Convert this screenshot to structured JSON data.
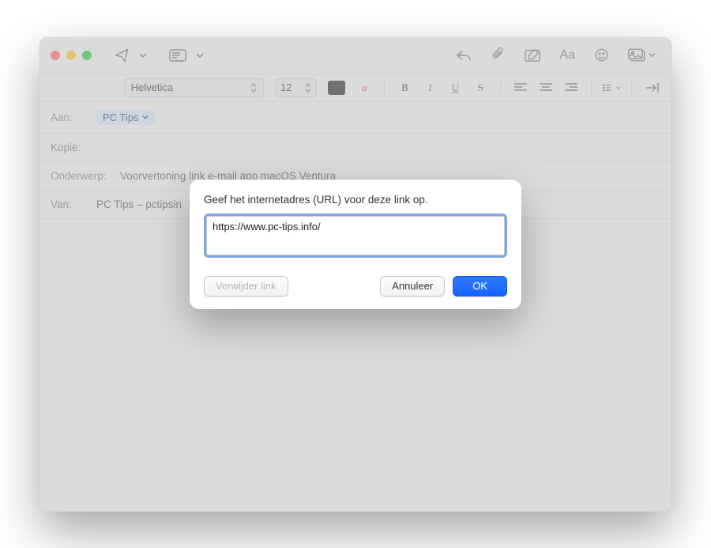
{
  "format": {
    "font": "Helvetica",
    "size": "12"
  },
  "fields": {
    "to_label": "Aan:",
    "to_recipient": "PC Tips",
    "cc_label": "Kopie:",
    "subject_label": "Onderwerp:",
    "subject_value": "Voorvertoning link e-mail app macOS Ventura",
    "from_label": "Van:",
    "from_value": "PC Tips – pctipsin"
  },
  "modal": {
    "title": "Geef het internetadres (URL) voor deze link op.",
    "url_value": "https://www.pc-tips.info/",
    "remove_label": "Verwijder link",
    "cancel_label": "Annuleer",
    "ok_label": "OK"
  }
}
